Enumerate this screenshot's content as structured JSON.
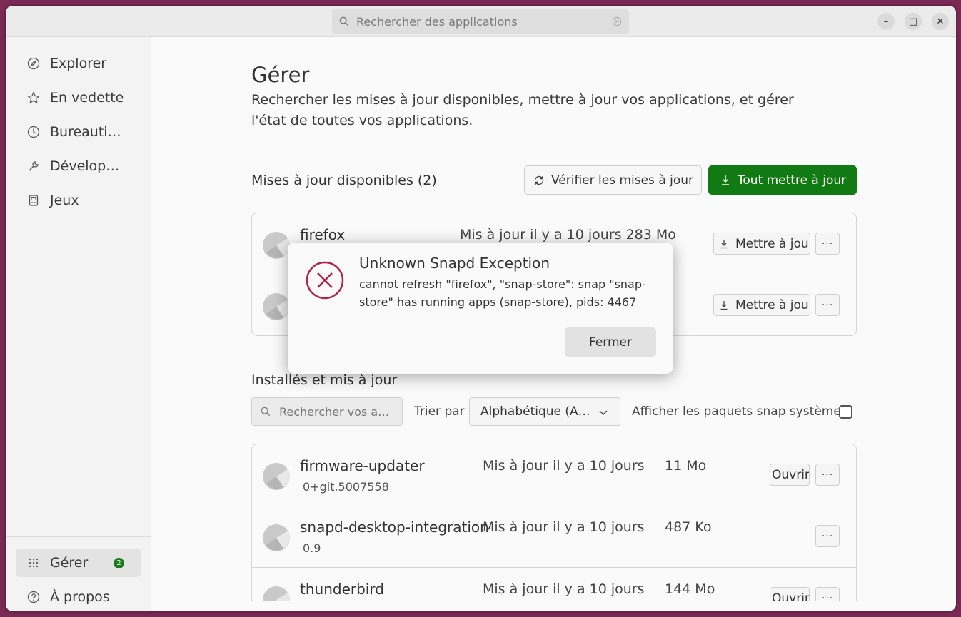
{
  "titlebar": {
    "search_placeholder": "Rechercher des applications",
    "minimize": "–",
    "maximize": "□",
    "close": "✕"
  },
  "sidebar": {
    "items": [
      {
        "label": "Explorer",
        "icon": "compass-icon"
      },
      {
        "label": "En vedette",
        "icon": "star-icon"
      },
      {
        "label": "Bureauti…",
        "icon": "clock-icon"
      },
      {
        "label": "Dévelop…",
        "icon": "wrench-icon"
      },
      {
        "label": "Jeux",
        "icon": "gamepad-icon"
      }
    ],
    "bottom": {
      "manage_label": "Gérer",
      "manage_badge": "2",
      "about_label": "À propos"
    }
  },
  "main": {
    "title": "Gérer",
    "description": "Rechercher les mises à jour disponibles, mettre à jour vos applications, et gérer l'état de toutes vos applications.",
    "updates": {
      "title": "Mises à jour disponibles (2)",
      "check_button": "Vérifier les mises à jour",
      "update_all_button": "Tout mettre à jour",
      "items": [
        {
          "name": "firefox",
          "date_size": "Mis à jour il y a 10 jours 283 Mo",
          "button": "Mettre à jour"
        },
        {
          "name": "",
          "date_size": "",
          "button": "Mettre à jour"
        }
      ]
    },
    "installed": {
      "title": "Installés et mis à jour",
      "search_placeholder": "Rechercher vos a…",
      "sort_label": "Trier par",
      "sort_value": "Alphabétique (A…",
      "snap_label": "Afficher les paquets snap système",
      "items": [
        {
          "name": "firmware-updater",
          "version": "0+git.5007558",
          "date": "Mis à jour il y a 10 jours",
          "size": "11 Mo",
          "button": "Ouvrir"
        },
        {
          "name": "snapd-desktop-integration",
          "version": "0.9",
          "date": "Mis à jour il y a 10 jours",
          "size": "487 Ko",
          "button": ""
        },
        {
          "name": "thunderbird",
          "version": "",
          "date": "Mis à jour il y a 10 jours",
          "size": "144 Mo",
          "button": "Ouvrir"
        }
      ],
      "more": "···"
    }
  },
  "dialog": {
    "title": "Unknown Snapd Exception",
    "message": "cannot refresh \"firefox\", \"snap-store\": snap \"snap-store\" has running apps (snap-store), pids: 4467",
    "close_button": "Fermer",
    "icon": "error-circle-icon"
  },
  "colors": {
    "accent_green": "#127a12",
    "error_red": "#b0234a",
    "desktop_bg": "#7a2a55"
  }
}
